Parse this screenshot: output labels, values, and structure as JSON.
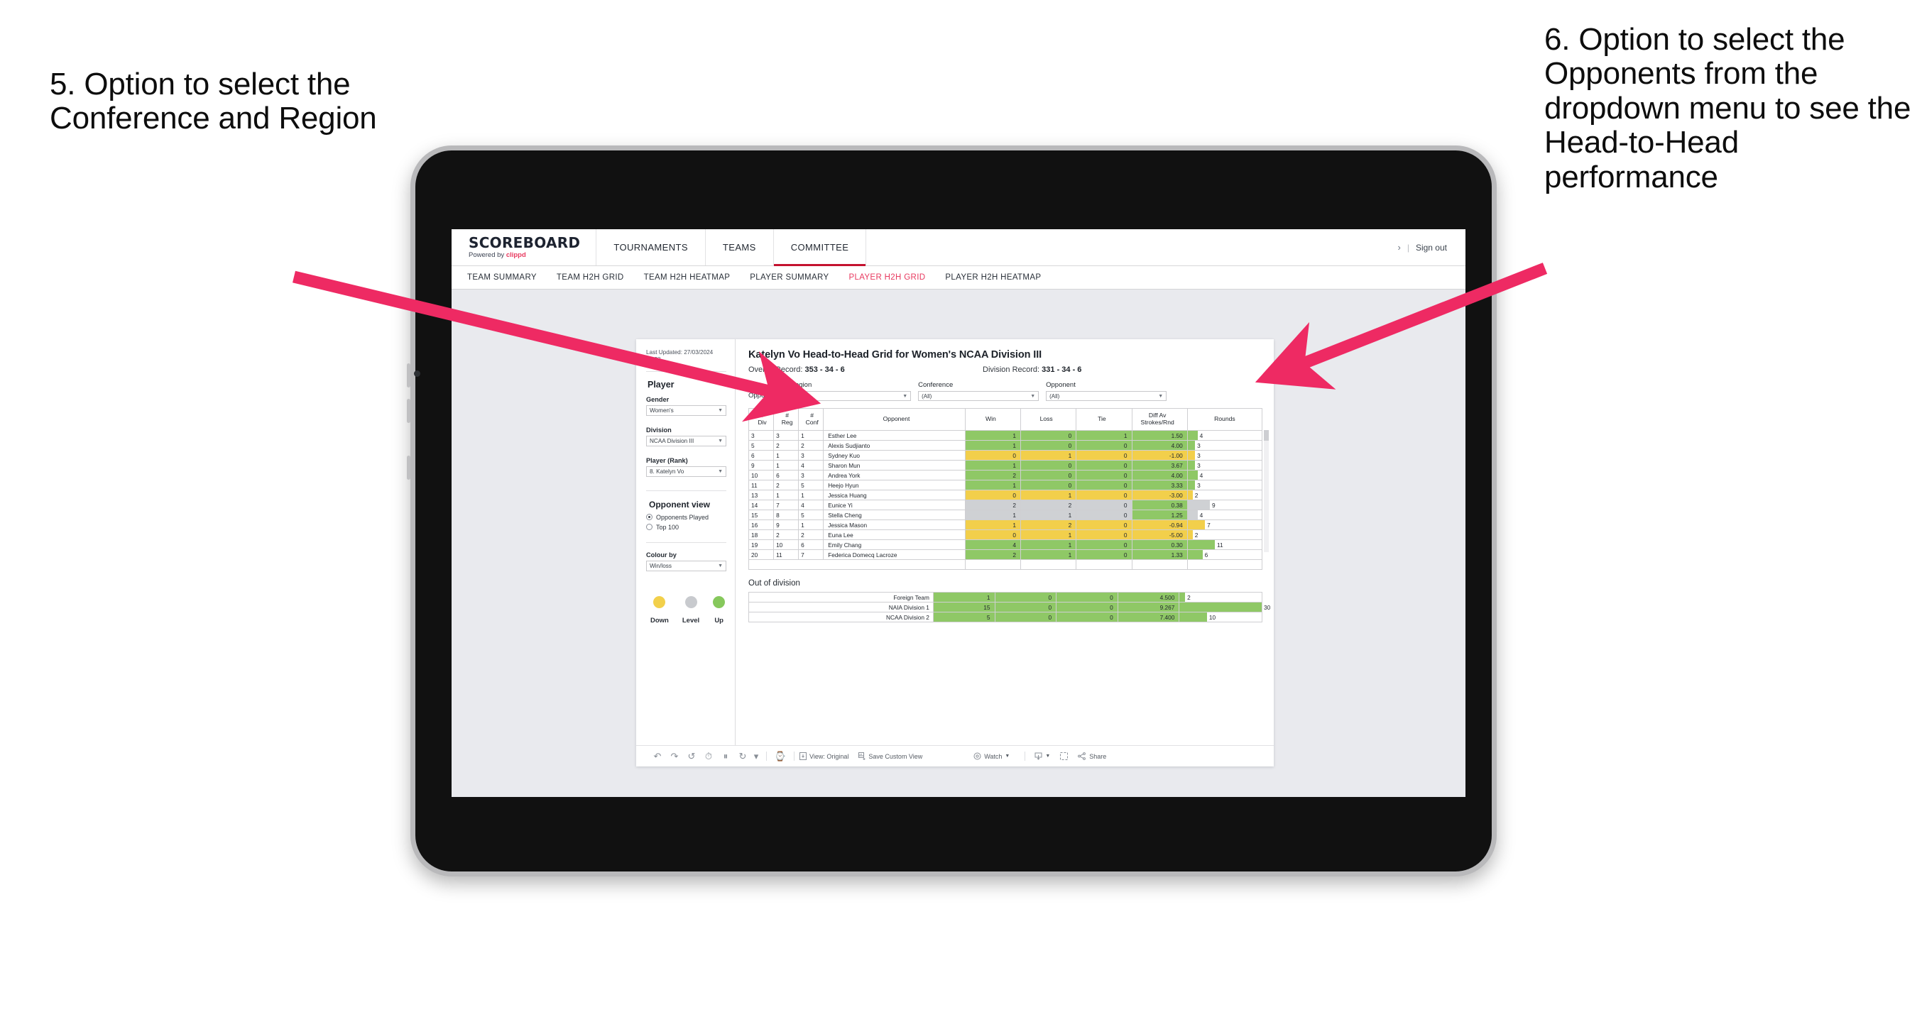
{
  "annotations": {
    "left": "5. Option to select the Conference and Region",
    "right": "6. Option to select the Opponents from the dropdown menu to see the Head-to-Head performance",
    "arrow_color": "#ee2a63"
  },
  "app": {
    "logo": {
      "main": "SCOREBOARD",
      "powered_prefix": "Powered by ",
      "brand": "clippd"
    },
    "nav": [
      {
        "label": "TOURNAMENTS",
        "active": false
      },
      {
        "label": "TEAMS",
        "active": false
      },
      {
        "label": "COMMITTEE",
        "active": true
      }
    ],
    "header_right": {
      "chevron": "›",
      "separator": "|",
      "sign_out": "Sign out"
    },
    "subtabs": [
      {
        "label": "TEAM SUMMARY",
        "active": false
      },
      {
        "label": "TEAM H2H GRID",
        "active": false
      },
      {
        "label": "TEAM H2H HEATMAP",
        "active": false
      },
      {
        "label": "PLAYER SUMMARY",
        "active": false
      },
      {
        "label": "PLAYER H2H GRID",
        "active": true
      },
      {
        "label": "PLAYER H2H HEATMAP",
        "active": false
      }
    ],
    "accent": "#e8395f"
  },
  "sidebar": {
    "last_updated_line1": "Last Updated: 27/03/2024",
    "last_updated_line2": "15:38",
    "player_heading": "Player",
    "fields": [
      {
        "label": "Gender",
        "value": "Women's"
      },
      {
        "label": "Division",
        "value": "NCAA Division III"
      },
      {
        "label": "Player (Rank)",
        "value": "8. Katelyn Vo"
      }
    ],
    "opponent_view": {
      "heading": "Opponent view",
      "options": [
        {
          "label": "Opponents Played",
          "selected": true
        },
        {
          "label": "Top 100",
          "selected": false
        }
      ]
    },
    "colour_by": {
      "label": "Colour by",
      "value": "Win/loss"
    },
    "legend": [
      {
        "label": "Down",
        "color": "#f2d04b"
      },
      {
        "label": "Level",
        "color": "#c8cace"
      },
      {
        "label": "Up",
        "color": "#86c85c"
      }
    ]
  },
  "viz": {
    "title": "Katelyn Vo Head-to-Head Grid for Women's NCAA Division III",
    "overall_record_label": "Overall Record:",
    "overall_record_value": "353 -  34 - 6",
    "division_record_label": "Division Record:",
    "division_record_value": "331 -  34 - 6",
    "filters_label": "Opponents:",
    "filters": [
      {
        "label": "Region",
        "value": "(All)"
      },
      {
        "label": "Conference",
        "value": "(All)"
      },
      {
        "label": "Opponent",
        "value": "(All)"
      }
    ],
    "out_of_division_title": "Out of division"
  },
  "chart_data": {
    "type": "table",
    "title": "Katelyn Vo Head-to-Head Grid for Women's NCAA Division III",
    "columns": [
      "# Div",
      "# Reg",
      "# Conf",
      "Opponent",
      "Win",
      "Loss",
      "Tie",
      "Diff Av Strokes/Rnd",
      "Rounds"
    ],
    "column_header_lines": [
      [
        "#",
        "Div"
      ],
      [
        "#",
        "Reg"
      ],
      [
        "#",
        "Conf"
      ],
      [
        "Opponent"
      ],
      [
        "Win"
      ],
      [
        "Loss"
      ],
      [
        "Tie"
      ],
      [
        "Diff Av",
        "Strokes/Rnd"
      ],
      [
        "Rounds"
      ]
    ],
    "rounds_max": 30,
    "rows": [
      {
        "div": "3",
        "reg": "3",
        "conf": "1",
        "opponent": "Esther Lee",
        "win": "1",
        "loss": "0",
        "tie": "1",
        "diff": "1.50",
        "rounds": "4",
        "state": "up"
      },
      {
        "div": "5",
        "reg": "2",
        "conf": "2",
        "opponent": "Alexis Sudjianto",
        "win": "1",
        "loss": "0",
        "tie": "0",
        "diff": "4.00",
        "rounds": "3",
        "state": "up"
      },
      {
        "div": "6",
        "reg": "1",
        "conf": "3",
        "opponent": "Sydney Kuo",
        "win": "0",
        "loss": "1",
        "tie": "0",
        "diff": "-1.00",
        "rounds": "3",
        "state": "down"
      },
      {
        "div": "9",
        "reg": "1",
        "conf": "4",
        "opponent": "Sharon Mun",
        "win": "1",
        "loss": "0",
        "tie": "0",
        "diff": "3.67",
        "rounds": "3",
        "state": "up"
      },
      {
        "div": "10",
        "reg": "6",
        "conf": "3",
        "opponent": "Andrea York",
        "win": "2",
        "loss": "0",
        "tie": "0",
        "diff": "4.00",
        "rounds": "4",
        "state": "up"
      },
      {
        "div": "11",
        "reg": "2",
        "conf": "5",
        "opponent": "Heejo Hyun",
        "win": "1",
        "loss": "0",
        "tie": "0",
        "diff": "3.33",
        "rounds": "3",
        "state": "up"
      },
      {
        "div": "13",
        "reg": "1",
        "conf": "1",
        "opponent": "Jessica Huang",
        "win": "0",
        "loss": "1",
        "tie": "0",
        "diff": "-3.00",
        "rounds": "2",
        "state": "down"
      },
      {
        "div": "14",
        "reg": "7",
        "conf": "4",
        "opponent": "Eunice Yi",
        "win": "2",
        "loss": "2",
        "tie": "0",
        "diff": "0.38",
        "rounds": "9",
        "state": "level",
        "diff_state": "up"
      },
      {
        "div": "15",
        "reg": "8",
        "conf": "5",
        "opponent": "Stella Cheng",
        "win": "1",
        "loss": "1",
        "tie": "0",
        "diff": "1.25",
        "rounds": "4",
        "state": "level",
        "diff_state": "up"
      },
      {
        "div": "16",
        "reg": "9",
        "conf": "1",
        "opponent": "Jessica Mason",
        "win": "1",
        "loss": "2",
        "tie": "0",
        "diff": "-0.94",
        "rounds": "7",
        "state": "down"
      },
      {
        "div": "18",
        "reg": "2",
        "conf": "2",
        "opponent": "Euna Lee",
        "win": "0",
        "loss": "1",
        "tie": "0",
        "diff": "-5.00",
        "rounds": "2",
        "state": "down"
      },
      {
        "div": "19",
        "reg": "10",
        "conf": "6",
        "opponent": "Emily Chang",
        "win": "4",
        "loss": "1",
        "tie": "0",
        "diff": "0.30",
        "rounds": "11",
        "state": "up"
      },
      {
        "div": "20",
        "reg": "11",
        "conf": "7",
        "opponent": "Federica Domecq Lacroze",
        "win": "2",
        "loss": "1",
        "tie": "0",
        "diff": "1.33",
        "rounds": "6",
        "state": "up"
      }
    ],
    "out_of_division": [
      {
        "name": "Foreign Team",
        "win": "1",
        "loss": "0",
        "tie": "0",
        "diff": "4.500",
        "rounds": "2",
        "state": "up"
      },
      {
        "name": "NAIA Division 1",
        "win": "15",
        "loss": "0",
        "tie": "0",
        "diff": "9.267",
        "rounds": "30",
        "state": "up"
      },
      {
        "name": "NCAA Division 2",
        "win": "5",
        "loss": "0",
        "tie": "0",
        "diff": "7.400",
        "rounds": "10",
        "state": "up"
      }
    ]
  },
  "toolbar": {
    "view_label": "View: Original",
    "save_label": "Save Custom View",
    "watch_label": "Watch",
    "share_label": "Share"
  }
}
